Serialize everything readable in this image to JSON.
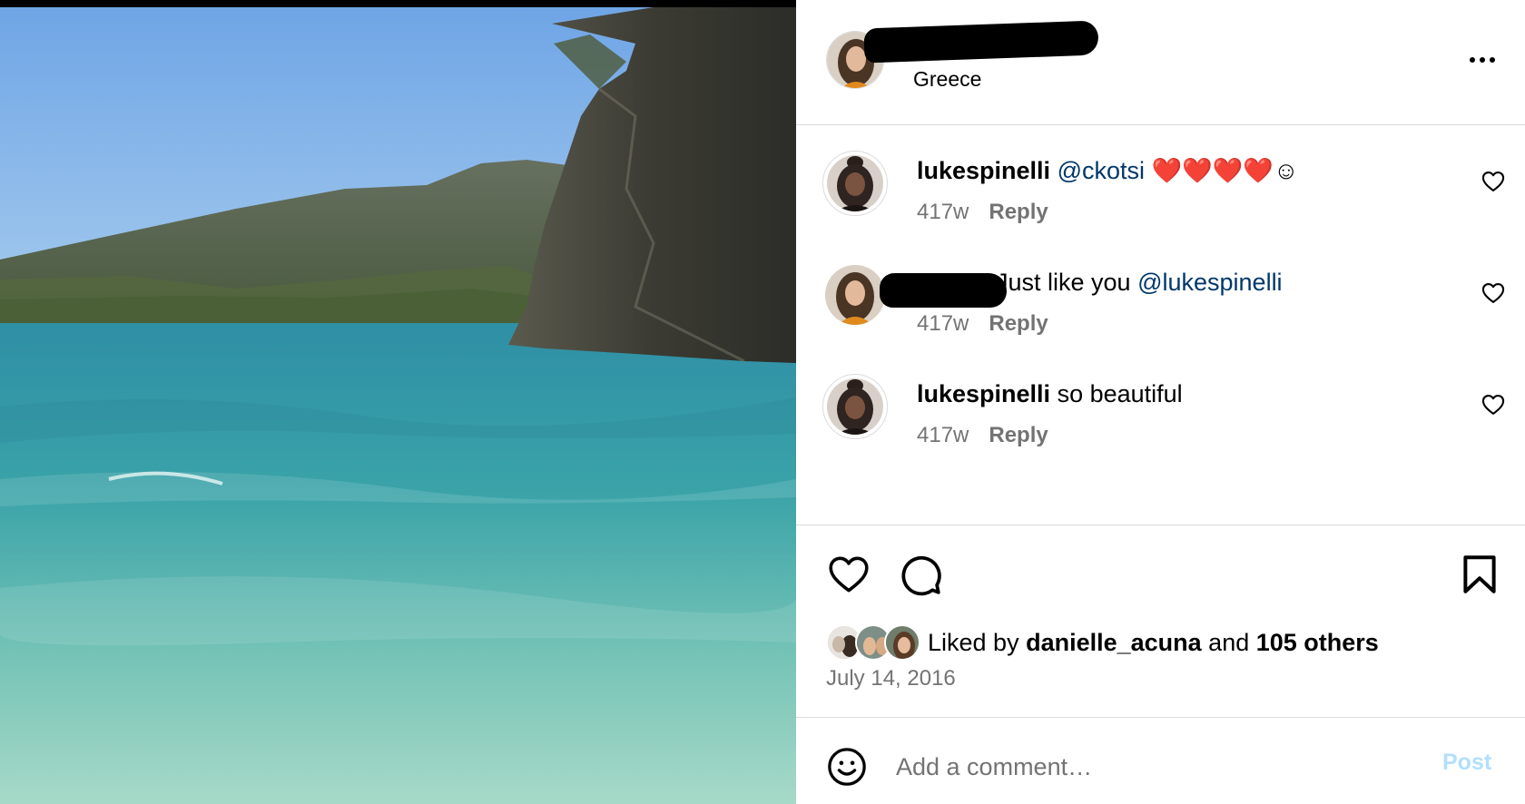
{
  "post": {
    "location": "Greece",
    "photo_alt_icon": "beach-photo",
    "date": "July 14, 2016"
  },
  "comments": [
    {
      "username": "lukespinelli",
      "mention": "@ckotsi",
      "text": " ❤️❤️❤️❤️☺",
      "age": "417w",
      "reply_label": "Reply"
    },
    {
      "username": "",
      "text": "Just like you ",
      "mention": "@lukespinelli",
      "age": "417w",
      "reply_label": "Reply"
    },
    {
      "username": "lukespinelli",
      "text": " so beautiful",
      "age": "417w",
      "reply_label": "Reply"
    }
  ],
  "likes": {
    "prefix": "Liked by ",
    "user": "danielle_acuna",
    "middle": " and ",
    "others": "105 others"
  },
  "comment_box": {
    "placeholder": "Add a comment…",
    "post_label": "Post"
  },
  "colors": {
    "mention": "#00376b",
    "meta": "#737373",
    "post_disabled": "#b2dffc",
    "separator": "#dbdbdb"
  }
}
